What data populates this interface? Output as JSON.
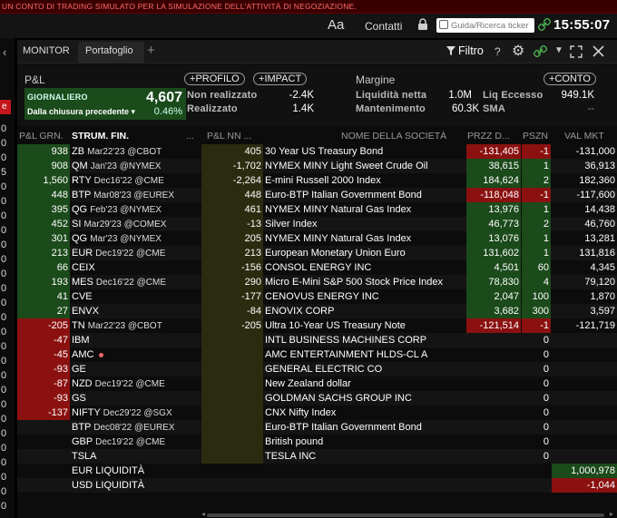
{
  "banner": "UN CONTO DI TRADING SIMULATO PER LA SIMULAZIONE DELL'ATTIVITÀ DI NEGOZIAZIONE.",
  "topbar": {
    "font_size_label": "Aa",
    "contacts": "Contatti",
    "search_placeholder": "Guida/Ricerca ticker",
    "clock": "15:55:07"
  },
  "left_strip": {
    "arrow": "‹",
    "badge": "e",
    "numbers": [
      "0",
      "0",
      "0",
      "5",
      "0",
      "0",
      "0",
      "0",
      "0",
      "0",
      "0",
      "0",
      "0",
      "0",
      "0",
      "0",
      "0",
      "0",
      "0",
      "0",
      "0",
      "0",
      "0",
      "0",
      "0",
      "0",
      "0"
    ]
  },
  "tabs": [
    {
      "label": "MONITOR"
    },
    {
      "label": "Portafoglio"
    }
  ],
  "header": {
    "filter": "Filtro",
    "help": "?"
  },
  "pnl": {
    "title": "P&L",
    "profile_btn": "PROFILO",
    "impact_btn": "IMPACT",
    "daily_label": "GIORNALIERO",
    "daily_value": "4,607",
    "since_prev_label": "Dalla chiusura precedente",
    "since_prev_value": "0.46%",
    "unrealized_label": "Non realizzato",
    "unrealized_value": "-2.4K",
    "realized_label": "Realizzato",
    "realized_value": "1.4K"
  },
  "margin": {
    "title": "Margine",
    "account_btn": "CONTO",
    "net_liq_label": "Liquidità netta",
    "net_liq_value": "1.0M",
    "excess_liq_label": "Liq Eccesso",
    "excess_liq_value": "949.1K",
    "maintenance_label": "Mantenimento",
    "maintenance_value": "60.3K",
    "sma_label": "SMA",
    "sma_value": "--"
  },
  "columns": {
    "pnl_day": "P&L GRN.",
    "instrument": "STRUM. FIN.",
    "dots1": "...",
    "pnl_nn": "P&L NN ...",
    "company": "NOME DELLA SOCIETÀ",
    "price": "PRZZ D...",
    "position": "PSZN",
    "market_value": "VAL MKT"
  },
  "rows": [
    {
      "pnl": "938",
      "sym": "ZB",
      "ex": "Mar22'23 @CBOT",
      "pnlnn": "405",
      "name": "30 Year US Treasury Bond",
      "price": "-131,405",
      "pos": "-1",
      "val": "-131,000",
      "neg": false,
      "short": true
    },
    {
      "pnl": "908",
      "sym": "QM",
      "ex": "Jan'23 @NYMEX",
      "pnlnn": "-1,702",
      "name": "NYMEX MINY Light Sweet Crude Oil",
      "price": "38,615",
      "pos": "1",
      "val": "36,913",
      "neg": false,
      "short": false
    },
    {
      "pnl": "1,560",
      "sym": "RTY",
      "ex": "Dec16'22 @CME",
      "pnlnn": "-2,264",
      "name": "E-mini Russell 2000 Index",
      "price": "184,624",
      "pos": "2",
      "val": "182,360",
      "neg": false,
      "short": false
    },
    {
      "pnl": "448",
      "sym": "BTP",
      "ex": "Mar08'23 @EUREX",
      "pnlnn": "448",
      "name": "Euro-BTP Italian Government Bond",
      "price": "-118,048",
      "pos": "-1",
      "val": "-117,600",
      "neg": false,
      "short": true
    },
    {
      "pnl": "395",
      "sym": "QG",
      "ex": "Feb'23 @NYMEX",
      "pnlnn": "461",
      "name": "NYMEX MINY Natural Gas Index",
      "price": "13,976",
      "pos": "1",
      "val": "14,438",
      "neg": false,
      "short": false
    },
    {
      "pnl": "452",
      "sym": "SI",
      "ex": "Mar29'23 @COMEX",
      "pnlnn": "-13",
      "name": "Silver Index",
      "price": "46,773",
      "pos": "2",
      "val": "46,760",
      "neg": false,
      "short": false
    },
    {
      "pnl": "301",
      "sym": "QG",
      "ex": "Mar'23 @NYMEX",
      "pnlnn": "205",
      "name": "NYMEX MINY Natural Gas Index",
      "price": "13,076",
      "pos": "1",
      "val": "13,281",
      "neg": false,
      "short": false
    },
    {
      "pnl": "213",
      "sym": "EUR",
      "ex": "Dec19'22 @CME",
      "pnlnn": "213",
      "name": "European Monetary Union Euro",
      "price": "131,602",
      "pos": "1",
      "val": "131,816",
      "neg": false,
      "short": false
    },
    {
      "pnl": "66",
      "sym": "CEIX",
      "ex": "",
      "pnlnn": "-156",
      "name": "CONSOL ENERGY INC",
      "price": "4,501",
      "pos": "60",
      "val": "4,345",
      "neg": false,
      "short": false
    },
    {
      "pnl": "193",
      "sym": "MES",
      "ex": "Dec16'22 @CME",
      "pnlnn": "290",
      "name": "Micro E-Mini S&P 500 Stock Price Index",
      "price": "78,830",
      "pos": "4",
      "val": "79,120",
      "neg": false,
      "short": false
    },
    {
      "pnl": "41",
      "sym": "CVE",
      "ex": "",
      "pnlnn": "-177",
      "name": "CENOVUS ENERGY INC",
      "price": "2,047",
      "pos": "100",
      "val": "1,870",
      "neg": false,
      "short": false
    },
    {
      "pnl": "27",
      "sym": "ENVX",
      "ex": "",
      "pnlnn": "-84",
      "name": "ENOVIX CORP",
      "price": "3,682",
      "pos": "300",
      "val": "3,597",
      "neg": false,
      "short": false
    },
    {
      "pnl": "-205",
      "sym": "TN",
      "ex": "Mar22'23 @CBOT",
      "pnlnn": "-205",
      "name": "Ultra 10-Year US Treasury Note",
      "price": "-121,514",
      "pos": "-1",
      "val": "-121,719",
      "neg": true,
      "short": true
    },
    {
      "pnl": "-47",
      "sym": "IBM",
      "ex": "",
      "pnlnn": "",
      "name": "INTL BUSINESS MACHINES CORP",
      "price": "",
      "pos": "0",
      "val": "",
      "neg": true,
      "short": false
    },
    {
      "pnl": "-45",
      "sym": "AMC",
      "ex": "",
      "pnlnn": "",
      "name": "AMC ENTERTAINMENT HLDS-CL A",
      "price": "",
      "pos": "0",
      "val": "",
      "neg": true,
      "short": false,
      "dot": true
    },
    {
      "pnl": "-93",
      "sym": "GE",
      "ex": "",
      "pnlnn": "",
      "name": "GENERAL ELECTRIC CO",
      "price": "",
      "pos": "0",
      "val": "",
      "neg": true,
      "short": false
    },
    {
      "pnl": "-87",
      "sym": "NZD",
      "ex": "Dec19'22 @CME",
      "pnlnn": "",
      "name": "New Zealand dollar",
      "price": "",
      "pos": "0",
      "val": "",
      "neg": true,
      "short": false
    },
    {
      "pnl": "-93",
      "sym": "GS",
      "ex": "",
      "pnlnn": "",
      "name": "GOLDMAN SACHS GROUP INC",
      "price": "",
      "pos": "0",
      "val": "",
      "neg": true,
      "short": false
    },
    {
      "pnl": "-137",
      "sym": "NIFTY",
      "ex": "Dec29'22 @SGX",
      "pnlnn": "",
      "name": "CNX Nifty Index",
      "price": "",
      "pos": "0",
      "val": "",
      "neg": true,
      "short": false
    },
    {
      "pnl": "",
      "sym": "BTP",
      "ex": "Dec08'22 @EUREX",
      "pnlnn": "",
      "name": "Euro-BTP Italian Government Bond",
      "price": "",
      "pos": "0",
      "val": "",
      "neg": false,
      "short": false
    },
    {
      "pnl": "",
      "sym": "GBP",
      "ex": "Dec19'22 @CME",
      "pnlnn": "",
      "name": "British pound",
      "price": "",
      "pos": "0",
      "val": "",
      "neg": false,
      "short": false
    },
    {
      "pnl": "",
      "sym": "TSLA",
      "ex": "",
      "pnlnn": "",
      "name": "TESLA INC",
      "price": "",
      "pos": "0",
      "val": "",
      "neg": false,
      "short": false
    }
  ],
  "cash": [
    {
      "label": "EUR LIQUIDITÀ",
      "value": "1,000,978",
      "neg": false
    },
    {
      "label": "USD LIQUIDITÀ",
      "value": "-1,044",
      "neg": true
    }
  ]
}
